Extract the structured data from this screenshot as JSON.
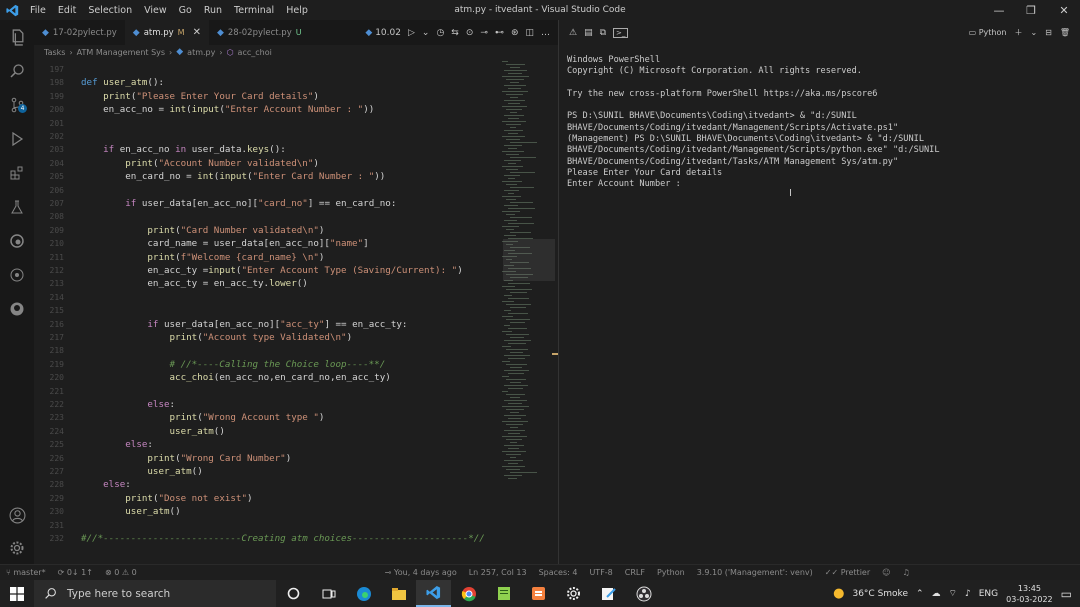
{
  "window": {
    "title": "atm.py - itvedant - Visual Studio Code"
  },
  "menu": [
    "File",
    "Edit",
    "Selection",
    "View",
    "Go",
    "Run",
    "Terminal",
    "Help"
  ],
  "tabs": [
    {
      "label": "17-02pylect.py",
      "status": ""
    },
    {
      "label": "atm.py",
      "status": "M"
    },
    {
      "label": "28-02pylect.py",
      "status": "U"
    }
  ],
  "editor_actions": {
    "run_label": "10.02"
  },
  "breadcrumb": [
    "Tasks",
    "ATM Management Sys",
    "atm.py",
    "acc_choi"
  ],
  "code_lines": [
    {
      "n": "197",
      "t": ""
    },
    {
      "n": "198",
      "t": "def user_atm():"
    },
    {
      "n": "199",
      "t": "    print(\"Please Enter Your Card details\")"
    },
    {
      "n": "200",
      "t": "    en_acc_no = int(input(\"Enter Account Number : \"))"
    },
    {
      "n": "201",
      "t": ""
    },
    {
      "n": "202",
      "t": ""
    },
    {
      "n": "203",
      "t": "    if en_acc_no in user_data.keys():"
    },
    {
      "n": "204",
      "t": "        print(\"Account Number validated\\n\")"
    },
    {
      "n": "205",
      "t": "        en_card_no = int(input(\"Enter Card Number : \"))"
    },
    {
      "n": "206",
      "t": ""
    },
    {
      "n": "207",
      "t": "        if user_data[en_acc_no][\"card_no\"] == en_card_no:"
    },
    {
      "n": "208",
      "t": ""
    },
    {
      "n": "209",
      "t": "            print(\"Card Number validated\\n\")"
    },
    {
      "n": "210",
      "t": "            card_name = user_data[en_acc_no][\"name\"]"
    },
    {
      "n": "211",
      "t": "            print(f\"Welcome {card_name} \\n\")"
    },
    {
      "n": "212",
      "t": "            en_acc_ty =input(\"Enter Account Type (Saving/Current): \")"
    },
    {
      "n": "213",
      "t": "            en_acc_ty = en_acc_ty.lower()"
    },
    {
      "n": "214",
      "t": ""
    },
    {
      "n": "215",
      "t": ""
    },
    {
      "n": "216",
      "t": "            if user_data[en_acc_no][\"acc_ty\"] == en_acc_ty:"
    },
    {
      "n": "217",
      "t": "                print(\"Account type Validated\\n\")"
    },
    {
      "n": "218",
      "t": ""
    },
    {
      "n": "219",
      "t": "                # //*----Calling the Choice loop----**/"
    },
    {
      "n": "220",
      "t": "                acc_choi(en_acc_no,en_card_no,en_acc_ty)"
    },
    {
      "n": "221",
      "t": ""
    },
    {
      "n": "222",
      "t": "            else:"
    },
    {
      "n": "223",
      "t": "                print(\"Wrong Account type \")"
    },
    {
      "n": "224",
      "t": "                user_atm()"
    },
    {
      "n": "225",
      "t": "        else:"
    },
    {
      "n": "226",
      "t": "            print(\"Wrong Card Number\")"
    },
    {
      "n": "227",
      "t": "            user_atm()"
    },
    {
      "n": "228",
      "t": "    else:"
    },
    {
      "n": "229",
      "t": "        print(\"Dose not exist\")"
    },
    {
      "n": "230",
      "t": "        user_atm()"
    },
    {
      "n": "231",
      "t": ""
    },
    {
      "n": "232",
      "t": "#//*-------------------------Creating atm choices---------------------*//"
    }
  ],
  "terminal": {
    "profile_label": "Python",
    "output": "Windows PowerShell\nCopyright (C) Microsoft Corporation. All rights reserved.\n\nTry the new cross-platform PowerShell https://aka.ms/pscore6\n\nPS D:\\SUNIL BHAVE\\Documents\\Coding\\itvedant> & \"d:/SUNIL BHAVE/Documents/Coding/itvedant/Management/Scripts/Activate.ps1\"\n(Management) PS D:\\SUNIL BHAVE\\Documents\\Coding\\itvedant> & \"d:/SUNIL BHAVE/Documents/Coding/itvedant/Management/Scripts/python.exe\" \"d:/SUNIL BHAVE/Documents/Coding/itvedant/Tasks/ATM Management Sys/atm.py\"\nPlease Enter Your Card details\nEnter Account Number : "
  },
  "statusbar": {
    "branch": "master*",
    "sync": "0↓ 1↑",
    "problems": "0 ⚠ 0",
    "blame": "You, 4 days ago",
    "position": "Ln 257, Col 13",
    "spaces": "Spaces: 4",
    "encoding": "UTF-8",
    "eol": "CRLF",
    "language": "Python",
    "interpreter": "3.9.10 ('Management': venv)",
    "prettier": "Prettier"
  },
  "taskbar": {
    "search_placeholder": "Type here to search",
    "weather": "36°C Smoke",
    "lang": "ENG",
    "time": "13:45",
    "date": "03-03-2022"
  }
}
